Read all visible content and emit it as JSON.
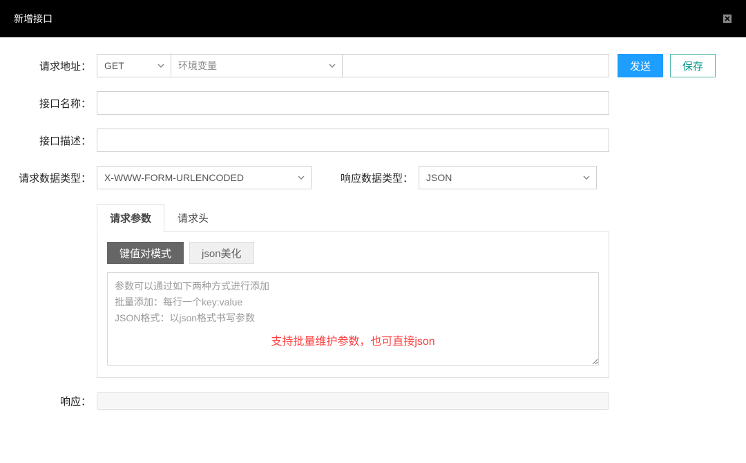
{
  "header": {
    "title": "新增接口"
  },
  "labels": {
    "request_url": "请求地址：",
    "api_name": "接口名称：",
    "api_desc": "接口描述：",
    "request_type": "请求数据类型：",
    "response_type": "响应数据类型：",
    "response": "响应："
  },
  "request_url": {
    "method": "GET",
    "env_placeholder": "环境变量",
    "url_value": ""
  },
  "buttons": {
    "send": "发送",
    "save": "保存",
    "kv_mode": "键值对模式",
    "json_beautify": "json美化"
  },
  "inputs": {
    "api_name": "",
    "api_desc": ""
  },
  "request_type": {
    "value": "X-WWW-FORM-URLENCODED"
  },
  "response_type": {
    "value": "JSON"
  },
  "tabs": {
    "params": "请求参数",
    "headers": "请求头"
  },
  "params_textarea": {
    "placeholder": "参数可以通过如下两种方式进行添加\n批量添加：每行一个key:value\nJSON格式：以json格式书写参数"
  },
  "annotation": "支持批量维护参数，也可直接json"
}
